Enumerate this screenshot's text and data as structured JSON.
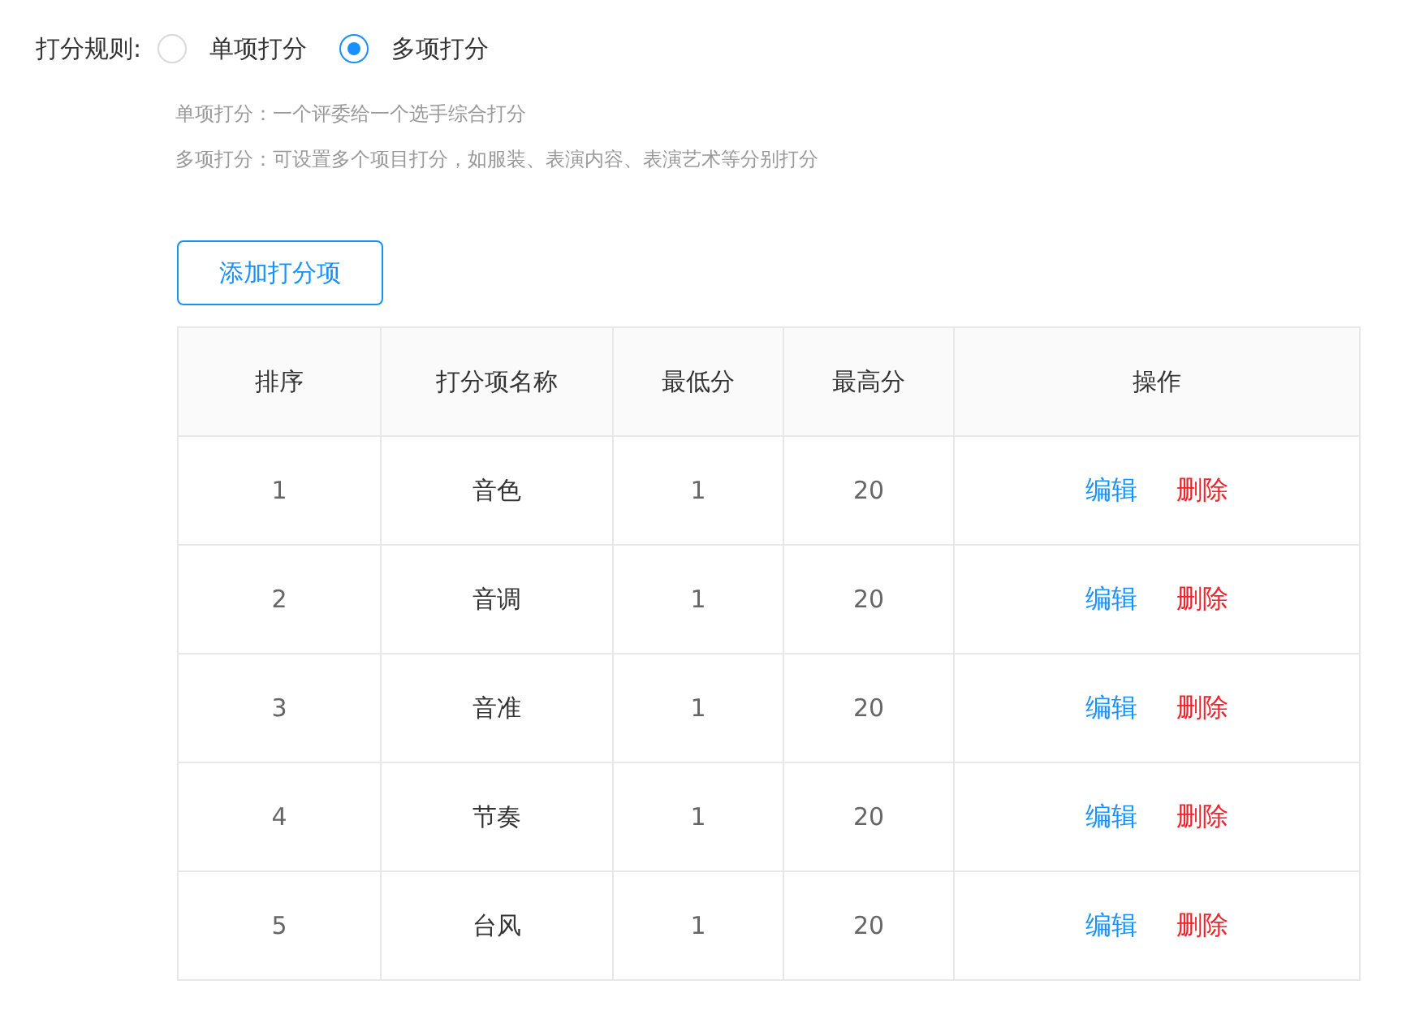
{
  "rule": {
    "label": "打分规则:",
    "options": [
      {
        "label": "单项打分",
        "selected": false
      },
      {
        "label": "多项打分",
        "selected": true
      }
    ],
    "hints": [
      "单项打分：一个评委给一个选手综合打分",
      "多项打分：可设置多个项目打分，如服装、表演内容、表演艺术等分别打分"
    ]
  },
  "add_button": "添加打分项",
  "table": {
    "columns": [
      "排序",
      "打分项名称",
      "最低分",
      "最高分",
      "操作"
    ],
    "rows": [
      {
        "cells": [
          "1",
          "音色",
          "1",
          "20"
        ],
        "actions": [
          "编辑",
          "删除"
        ]
      },
      {
        "cells": [
          "2",
          "音调",
          "1",
          "20"
        ],
        "actions": [
          "编辑",
          "删除"
        ]
      },
      {
        "cells": [
          "3",
          "音准",
          "1",
          "20"
        ],
        "actions": [
          "编辑",
          "删除"
        ]
      },
      {
        "cells": [
          "4",
          "节奏",
          "1",
          "20"
        ],
        "actions": [
          "编辑",
          "删除"
        ]
      },
      {
        "cells": [
          "5",
          "台风",
          "1",
          "20"
        ],
        "actions": [
          "编辑",
          "删除"
        ]
      }
    ]
  }
}
